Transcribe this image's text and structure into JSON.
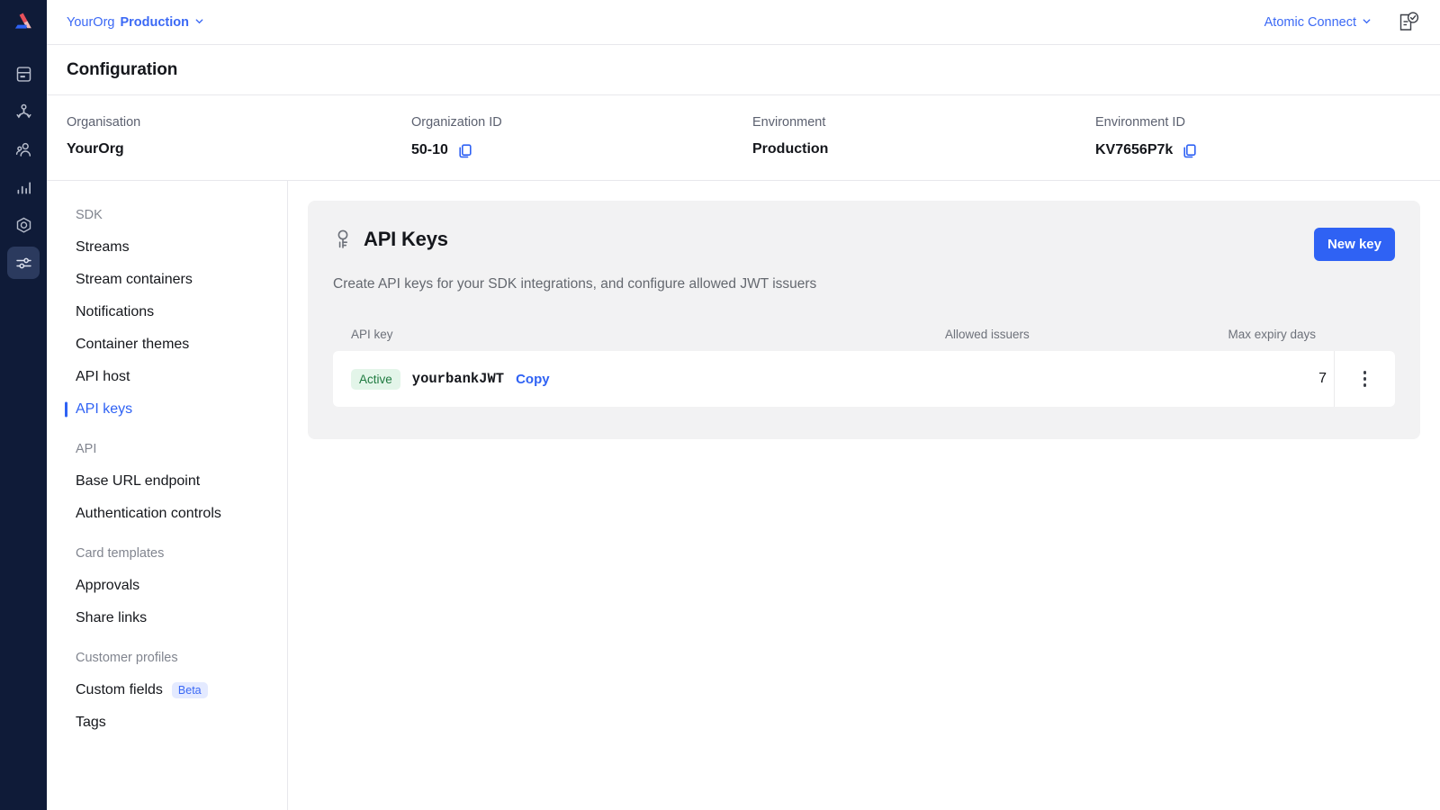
{
  "colors": {
    "rail_bg": "#0f1b38",
    "accent_blue": "#2f62f4",
    "link_blue": "#3b69f5",
    "card_bg": "#f2f2f3",
    "badge_green_text": "#1f7a40",
    "badge_green_bg": "#e3f5e9",
    "beta_blue_bg": "#e4eaff"
  },
  "rail": {
    "logo": "atomic-logo",
    "items": [
      {
        "icon": "cards-icon",
        "name": "rail-item-cards",
        "active": false
      },
      {
        "icon": "journeys-icon",
        "name": "rail-item-journeys",
        "active": false
      },
      {
        "icon": "customers-icon",
        "name": "rail-item-customers",
        "active": false
      },
      {
        "icon": "analytics-icon",
        "name": "rail-item-analytics",
        "active": false
      },
      {
        "icon": "hexagon-icon",
        "name": "rail-item-workbench",
        "active": false
      },
      {
        "icon": "sliders-icon",
        "name": "rail-item-configuration",
        "active": true
      }
    ]
  },
  "topbar": {
    "org_name": "YourOrg",
    "env_name": "Production",
    "chevron": "chevron-down-icon",
    "connect_label": "Atomic Connect",
    "connect_chevron": "chevron-down-icon",
    "doc_check_icon": "document-check-icon"
  },
  "page": {
    "title": "Configuration"
  },
  "info": [
    {
      "label": "Organisation",
      "value": "YourOrg",
      "copyable": false
    },
    {
      "label": "Organization ID",
      "value": "50-10",
      "copyable": true
    },
    {
      "label": "Environment",
      "value": "Production",
      "copyable": false
    },
    {
      "label": "Environment ID",
      "value": "KV7656P7k",
      "copyable": true
    }
  ],
  "nav": {
    "groups": [
      {
        "heading": "SDK",
        "items": [
          {
            "label": "Streams",
            "active": false
          },
          {
            "label": "Stream containers",
            "active": false
          },
          {
            "label": "Notifications",
            "active": false
          },
          {
            "label": "Container themes",
            "active": false
          },
          {
            "label": "API host",
            "active": false
          },
          {
            "label": "API keys",
            "active": true
          }
        ]
      },
      {
        "heading": "API",
        "items": [
          {
            "label": "Base URL endpoint",
            "active": false
          },
          {
            "label": "Authentication controls",
            "active": false
          }
        ]
      },
      {
        "heading": "Card templates",
        "items": [
          {
            "label": "Approvals",
            "active": false
          },
          {
            "label": "Share links",
            "active": false
          }
        ]
      },
      {
        "heading": "Customer profiles",
        "items": [
          {
            "label": "Custom fields",
            "active": false,
            "badge": "Beta"
          },
          {
            "label": "Tags",
            "active": false
          }
        ]
      }
    ]
  },
  "card": {
    "icon": "key-icon",
    "title": "API Keys",
    "subtitle": "Create API keys for your SDK integrations, and configure allowed JWT issuers",
    "new_key_label": "New key",
    "table": {
      "headers": {
        "api_key": "API key",
        "allowed_issuers": "Allowed issuers",
        "max_expiry_days": "Max expiry days"
      },
      "rows": [
        {
          "status": "Active",
          "name": "yourbankJWT",
          "copy_label": "Copy",
          "allowed_issuers": "",
          "max_expiry_days": "7",
          "menu_icon": "kebab-menu-icon"
        }
      ]
    }
  }
}
